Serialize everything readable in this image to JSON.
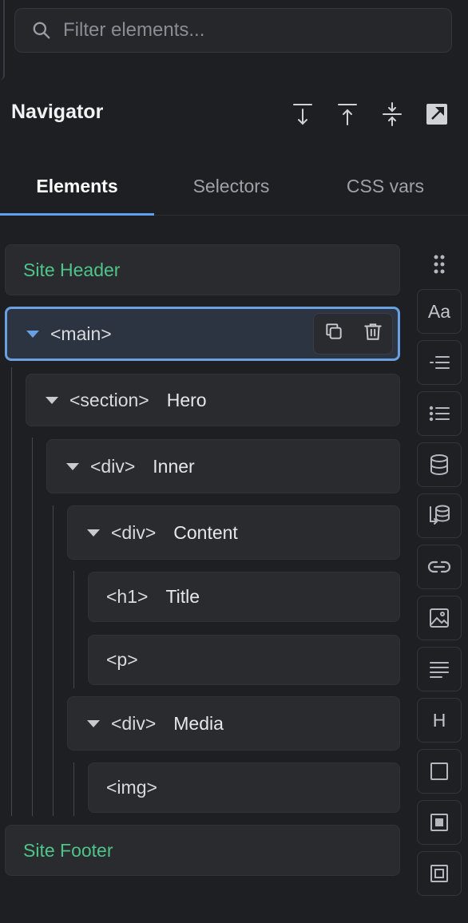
{
  "search": {
    "placeholder": "Filter elements..."
  },
  "navigator": {
    "title": "Navigator",
    "actions": [
      "collapse-down-icon",
      "expand-up-icon",
      "collapse-all-icon",
      "open-external-icon"
    ]
  },
  "tabs": [
    {
      "label": "Elements",
      "active": true
    },
    {
      "label": "Selectors",
      "active": false
    },
    {
      "label": "CSS vars",
      "active": false
    }
  ],
  "tree": {
    "site_header": "Site Header",
    "main": {
      "tag": "<main>"
    },
    "section": {
      "tag": "<section>",
      "label": "Hero"
    },
    "div_inner": {
      "tag": "<div>",
      "label": "Inner"
    },
    "div_content": {
      "tag": "<div>",
      "label": "Content"
    },
    "h1": {
      "tag": "<h1>",
      "label": "Title"
    },
    "p": {
      "tag": "<p>"
    },
    "div_media": {
      "tag": "<div>",
      "label": "Media"
    },
    "img": {
      "tag": "<img>"
    },
    "site_footer": "Site Footer"
  },
  "rail": {
    "text_button": "Aa",
    "heading_button": "H",
    "icons": [
      "drag-grip-icon",
      "typography-icon",
      "ordered-list-icon",
      "unordered-list-icon",
      "database-icon",
      "database-query-icon",
      "link-icon",
      "image-icon",
      "align-text-icon",
      "heading-icon",
      "container-icon",
      "block-icon",
      "section-icon"
    ]
  },
  "colors": {
    "accent": "#5aa2ef",
    "green": "#4fc48a",
    "background": "#1e1f22"
  }
}
